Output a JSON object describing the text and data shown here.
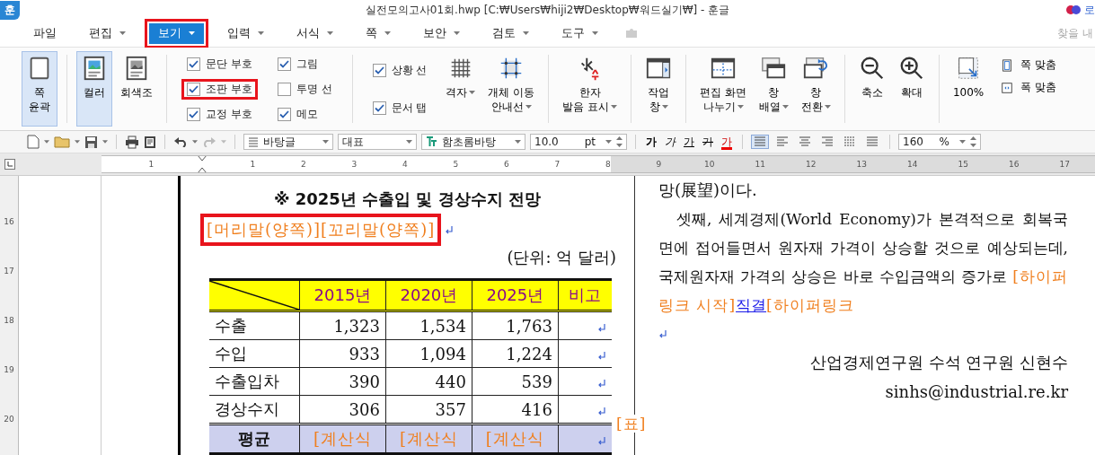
{
  "window": {
    "logo": "훈",
    "title": "실전모의고사01회.hwp [C:₩Users₩hiji2₩Desktop₩워드실기₩] - 훈글",
    "account": "로"
  },
  "menu": [
    {
      "label": "파일",
      "dropdown": false,
      "selected": false,
      "highlighted": false
    },
    {
      "label": "편집",
      "dropdown": true,
      "selected": false,
      "highlighted": false
    },
    {
      "label": "보기",
      "dropdown": true,
      "selected": true,
      "highlighted": true
    },
    {
      "label": "입력",
      "dropdown": true,
      "selected": false,
      "highlighted": false
    },
    {
      "label": "서식",
      "dropdown": true,
      "selected": false,
      "highlighted": false
    },
    {
      "label": "쪽",
      "dropdown": true,
      "selected": false,
      "highlighted": false
    },
    {
      "label": "보안",
      "dropdown": true,
      "selected": false,
      "highlighted": false
    },
    {
      "label": "검토",
      "dropdown": true,
      "selected": false,
      "highlighted": false
    },
    {
      "label": "도구",
      "dropdown": true,
      "selected": false,
      "highlighted": false
    }
  ],
  "search": {
    "placeholder": "찾을 내"
  },
  "ribbon": [
    {
      "kind": "big",
      "lines": [
        "쪽",
        "윤곽"
      ],
      "selected": true,
      "dropdown": false
    },
    {
      "kind": "sep"
    },
    {
      "kind": "big",
      "lines": [
        "컬러"
      ],
      "selected": true,
      "dropdown": false
    },
    {
      "kind": "big",
      "lines": [
        "회색조"
      ],
      "selected": false,
      "dropdown": false
    },
    {
      "kind": "sep"
    },
    {
      "kind": "checks",
      "items": [
        {
          "label": "문단 부호",
          "checked": true,
          "highlighted": false
        },
        {
          "label": "조판 부호",
          "checked": true,
          "highlighted": true
        },
        {
          "label": "교정 부호",
          "checked": true,
          "highlighted": false
        }
      ]
    },
    {
      "kind": "checks",
      "items": [
        {
          "label": "그림",
          "checked": true,
          "highlighted": false
        },
        {
          "label": "투명 선",
          "checked": false,
          "highlighted": false
        },
        {
          "label": "메모",
          "checked": true,
          "highlighted": false
        }
      ]
    },
    {
      "kind": "sep"
    },
    {
      "kind": "checks",
      "items": [
        {
          "label": "상황 선",
          "checked": true,
          "highlighted": false
        },
        {
          "label": "문서 탭",
          "checked": true,
          "highlighted": false
        }
      ]
    },
    {
      "kind": "big",
      "lines": [
        "격자"
      ],
      "selected": false,
      "dropdown": true
    },
    {
      "kind": "big",
      "lines": [
        "개체 이동",
        "안내선"
      ],
      "selected": false,
      "dropdown": true
    },
    {
      "kind": "sep"
    },
    {
      "kind": "big",
      "lines": [
        "한자",
        "발음 표시"
      ],
      "selected": false,
      "dropdown": true
    },
    {
      "kind": "sep"
    },
    {
      "kind": "big",
      "lines": [
        "작업",
        "창"
      ],
      "selected": false,
      "dropdown": true
    },
    {
      "kind": "sep"
    },
    {
      "kind": "big",
      "lines": [
        "편집 화면",
        "나누기"
      ],
      "selected": false,
      "dropdown": true
    },
    {
      "kind": "big",
      "lines": [
        "창",
        "배열"
      ],
      "selected": false,
      "dropdown": true
    },
    {
      "kind": "big",
      "lines": [
        "창",
        "전환"
      ],
      "selected": false,
      "dropdown": true
    },
    {
      "kind": "sep"
    },
    {
      "kind": "big",
      "lines": [
        "축소"
      ],
      "selected": false,
      "dropdown": false
    },
    {
      "kind": "big",
      "lines": [
        "확대"
      ],
      "selected": false,
      "dropdown": false
    },
    {
      "kind": "sep"
    },
    {
      "kind": "big",
      "lines": [
        "100%"
      ],
      "selected": false,
      "dropdown": false
    },
    {
      "kind": "small",
      "items": [
        {
          "label": "쪽 맞춤"
        },
        {
          "label": "폭 맞춤"
        }
      ]
    }
  ],
  "toolbar": {
    "style": "바탕글",
    "numbering": "대표",
    "font": "함초롬바탕",
    "size": "10.0",
    "unit": "pt",
    "format_buttons": [
      {
        "kind": "bold",
        "label": "가"
      },
      {
        "kind": "italic",
        "label": "가"
      },
      {
        "kind": "underline",
        "label": "가"
      },
      {
        "kind": "strike",
        "label": "가"
      },
      {
        "kind": "color",
        "label": "가"
      }
    ],
    "align_buttons": [
      {
        "selected": true
      },
      {
        "selected": false
      },
      {
        "selected": false
      },
      {
        "selected": false
      },
      {
        "selected": false
      },
      {
        "selected": false
      }
    ],
    "zoom": "160",
    "zoom_unit": "%"
  },
  "ruler": {
    "labels": [
      "1",
      "1",
      "2",
      "3",
      "4",
      "5",
      "6",
      "7",
      "8",
      "9",
      "10",
      "11",
      "12",
      "13",
      "14",
      "15",
      "16",
      "17"
    ]
  },
  "vertical_ruler": {
    "labels": [
      "16",
      "17",
      "18",
      "19",
      "20"
    ]
  },
  "document": {
    "title": "※ 2025년 수출입 및 경상수지 전망",
    "header_code": {
      "text": "[머리말(양쪽)][꼬리말(양쪽)]",
      "highlighted": true
    },
    "unit": "(단위: 억 달러)",
    "table": {
      "columns": [
        "2015년",
        "2020년",
        "2025년",
        "비고"
      ],
      "rows": [
        {
          "label": "수출",
          "values": [
            "1,323",
            "1,534",
            "1,763"
          ]
        },
        {
          "label": "수입",
          "values": [
            "933",
            "1,094",
            "1,224"
          ]
        },
        {
          "label": "수출입차",
          "values": [
            "390",
            "440",
            "539"
          ]
        },
        {
          "label": "경상수지",
          "values": [
            "306",
            "357",
            "416"
          ]
        }
      ],
      "footer": {
        "label": "평균",
        "values": [
          "[계산식",
          "[계산식",
          "[계산식"
        ]
      }
    },
    "table_code": "[표]",
    "right_column": {
      "top_line": "망(展望)이다.",
      "paragraph": [
        {
          "kind": "text",
          "text": "셋째, 세계경제(World Economy)가 본격적으로 회복국면에 접어들면서 원자재 가격이 상승할 것으로 예상되는데, 국제원자재 가격의 상승은 바로 수입금액의 증가로 "
        },
        {
          "kind": "code",
          "text": "[하이퍼링크 시작]"
        },
        {
          "kind": "link",
          "text": "직결"
        },
        {
          "kind": "code",
          "text": "[하이퍼링크"
        }
      ],
      "author": "산업경제연구원 수석 연구원 신현수",
      "email": "sinhs@industrial.re.kr"
    }
  }
}
